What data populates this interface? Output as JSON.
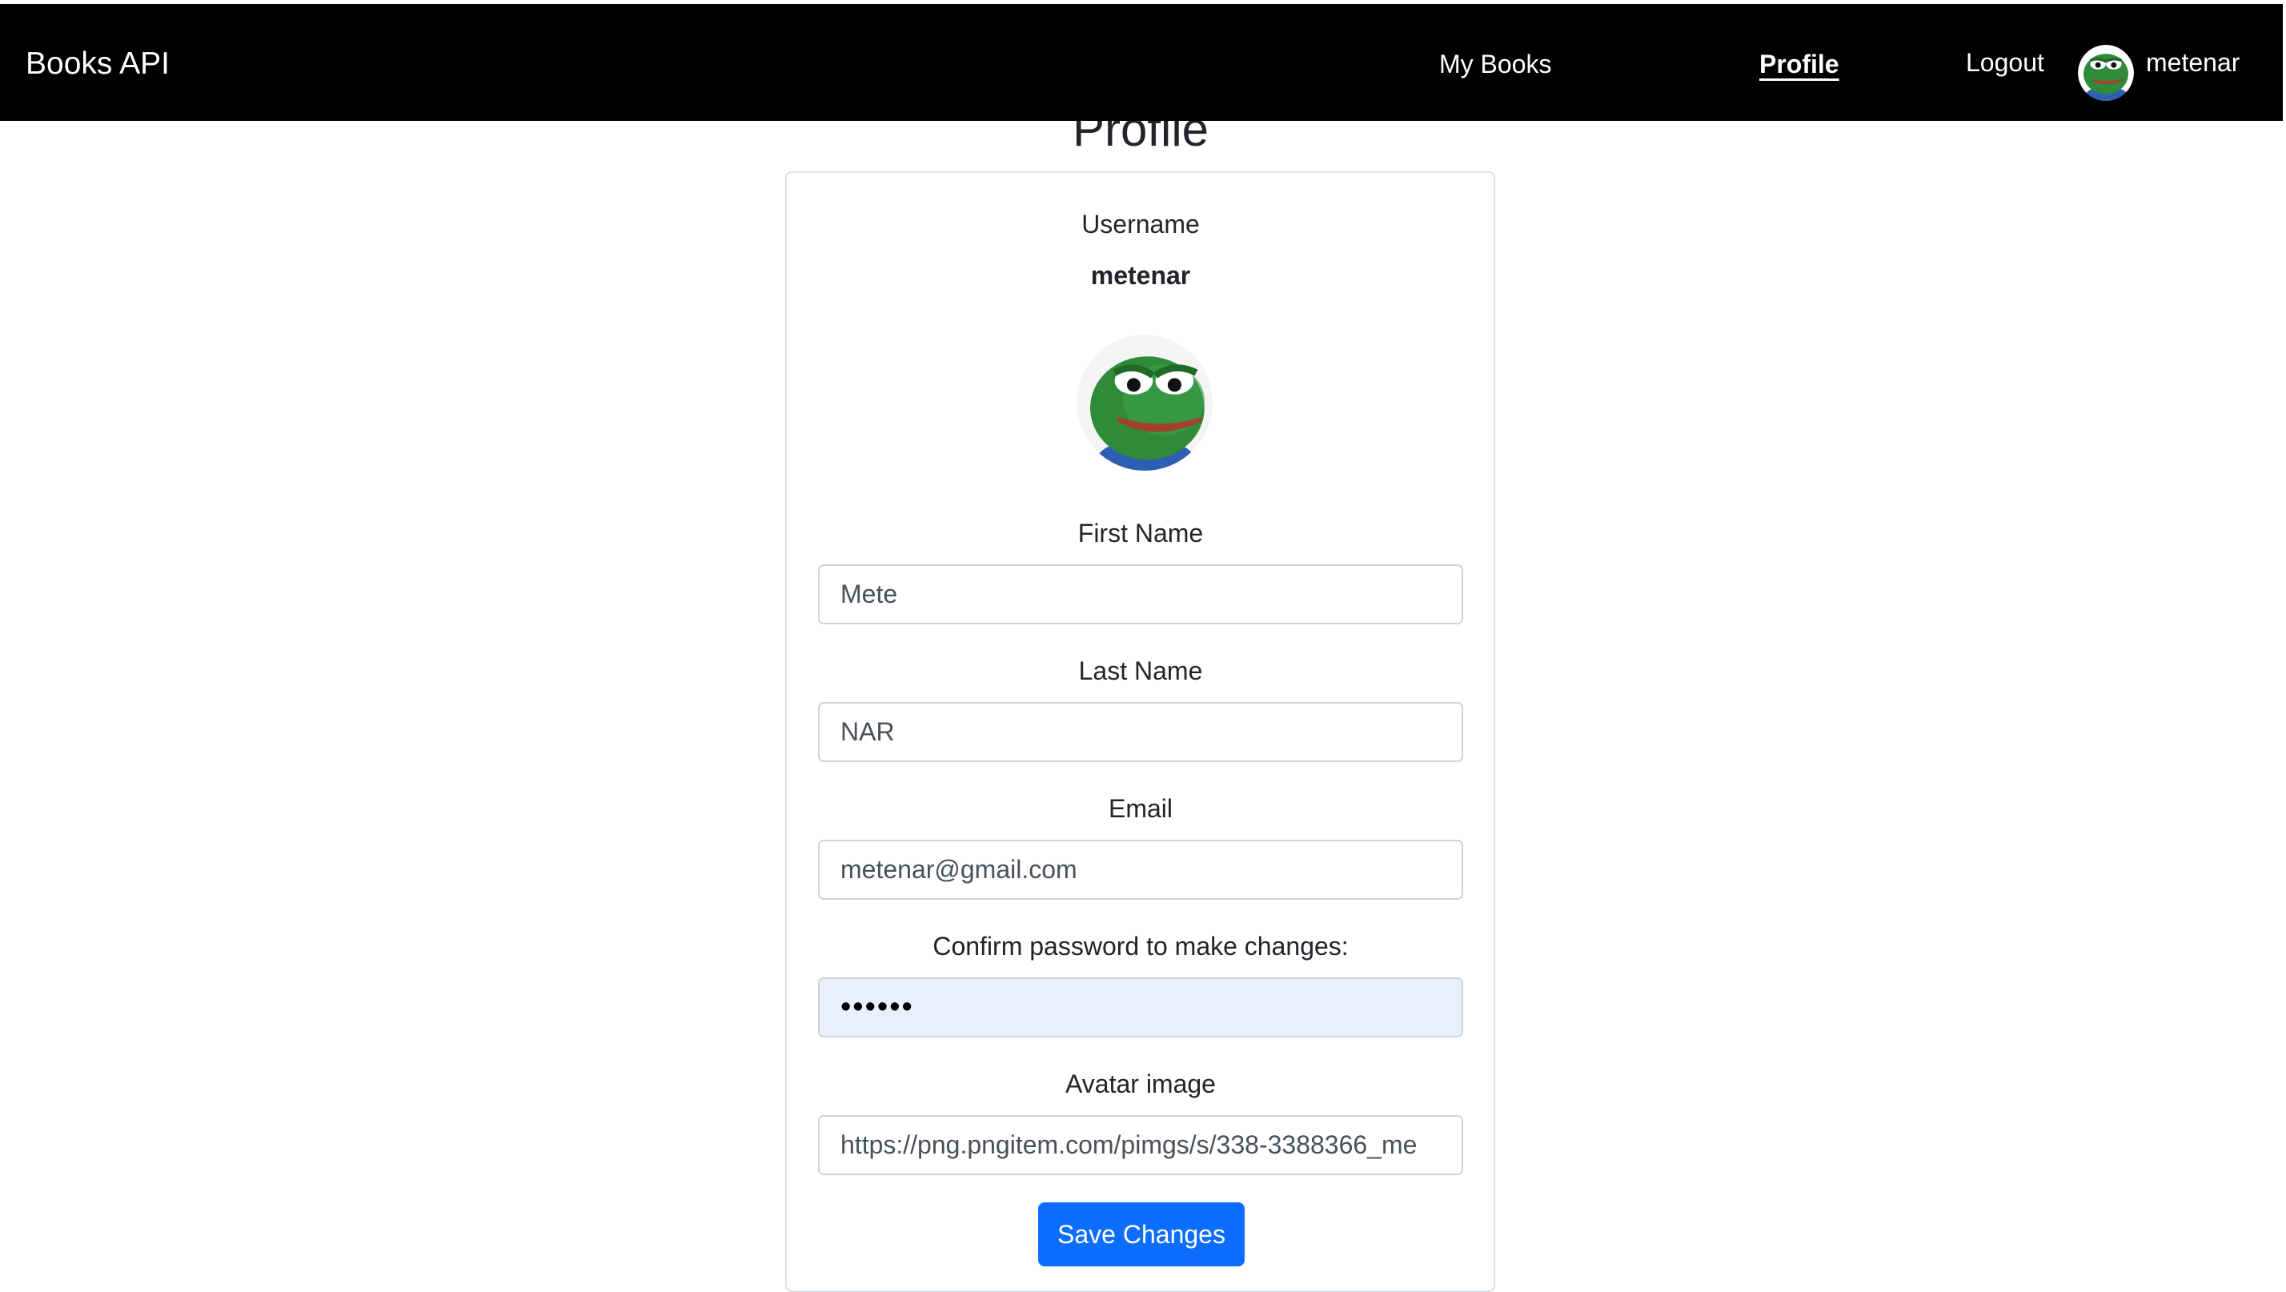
{
  "navbar": {
    "brand": "Books API",
    "links": {
      "my_books": "My Books",
      "profile": "Profile",
      "logout": "Logout"
    },
    "username": "metenar",
    "avatar_icon": "pepe-frog-avatar"
  },
  "page": {
    "title": "Profile"
  },
  "profile": {
    "username_label": "Username",
    "username": "metenar",
    "avatar_icon": "pepe-frog-avatar"
  },
  "form": {
    "first_name": {
      "label": "First Name",
      "value": "Mete"
    },
    "last_name": {
      "label": "Last Name",
      "value": "NAR"
    },
    "email": {
      "label": "Email",
      "value": "metenar@gmail.com"
    },
    "password": {
      "label": "Confirm password to make changes:",
      "value": "••••••"
    },
    "avatar_url": {
      "label": "Avatar image",
      "value": "https://png.pngitem.com/pimgs/s/338-3388366_me"
    },
    "save_label": "Save Changes"
  },
  "colors": {
    "navbar_bg": "#000000",
    "primary_button": "#0d6efd",
    "autofill_bg": "#e8f0fe"
  }
}
